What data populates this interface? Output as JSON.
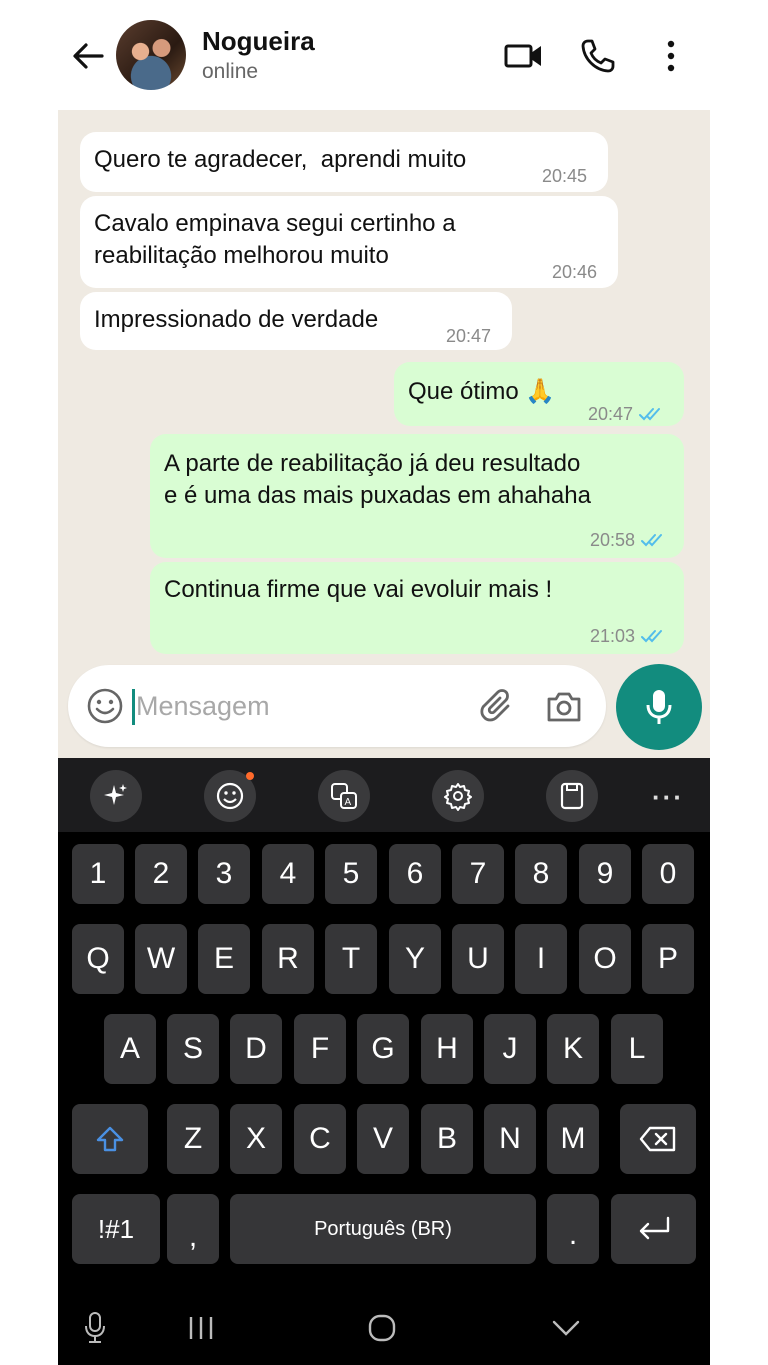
{
  "header": {
    "contact_name": "Nogueira",
    "status": "online",
    "icons": [
      "back-arrow-icon",
      "video-call-icon",
      "phone-icon",
      "more-vert-icon"
    ]
  },
  "messages": [
    {
      "direction": "in",
      "text": "Quero te agradecer,  aprendi muito",
      "time": "20:45"
    },
    {
      "direction": "in",
      "text": "Cavalo empinava segui certinho a\nreabilitação melhorou muito",
      "time": "20:46"
    },
    {
      "direction": "in",
      "text": "Impressionado de verdade",
      "time": "20:47"
    },
    {
      "direction": "out",
      "text": "Que ótimo 🙏",
      "time": "20:47",
      "status": "read"
    },
    {
      "direction": "out",
      "text": "A parte de reabilitação já deu resultado\ne é uma das mais puxadas em ahahaha",
      "time": "20:58",
      "status": "read"
    },
    {
      "direction": "out",
      "text": "Continua firme que vai evoluir mais !",
      "time": "21:03",
      "status": "read"
    }
  ],
  "composer": {
    "placeholder": "Mensagem",
    "value": ""
  },
  "colors": {
    "accent": "#128c7e",
    "incoming_bubble": "#ffffff",
    "outgoing_bubble": "#d9fdd3",
    "chat_bg": "#efeae2",
    "read_tick": "#53bdeb",
    "keyboard_bg": "#000000",
    "key_bg": "#363638"
  },
  "keyboard": {
    "toolbar": [
      "ai-sparkle-icon",
      "emoji-icon",
      "translate-icon",
      "settings-icon",
      "clipboard-icon",
      "more-horizontal-icon"
    ],
    "number_row": [
      "1",
      "2",
      "3",
      "4",
      "5",
      "6",
      "7",
      "8",
      "9",
      "0"
    ],
    "row1": [
      "Q",
      "W",
      "E",
      "R",
      "T",
      "Y",
      "U",
      "I",
      "O",
      "P"
    ],
    "row2": [
      "A",
      "S",
      "D",
      "F",
      "G",
      "H",
      "J",
      "K",
      "L"
    ],
    "row3": [
      "Z",
      "X",
      "C",
      "V",
      "B",
      "N",
      "M"
    ],
    "symbols_key": "!#1",
    "comma_key": ",",
    "space_label": "Português (BR)",
    "period_key": "."
  },
  "navbar": [
    "keyboard-mic-icon",
    "recents-icon",
    "home-icon",
    "hide-keyboard-icon"
  ]
}
